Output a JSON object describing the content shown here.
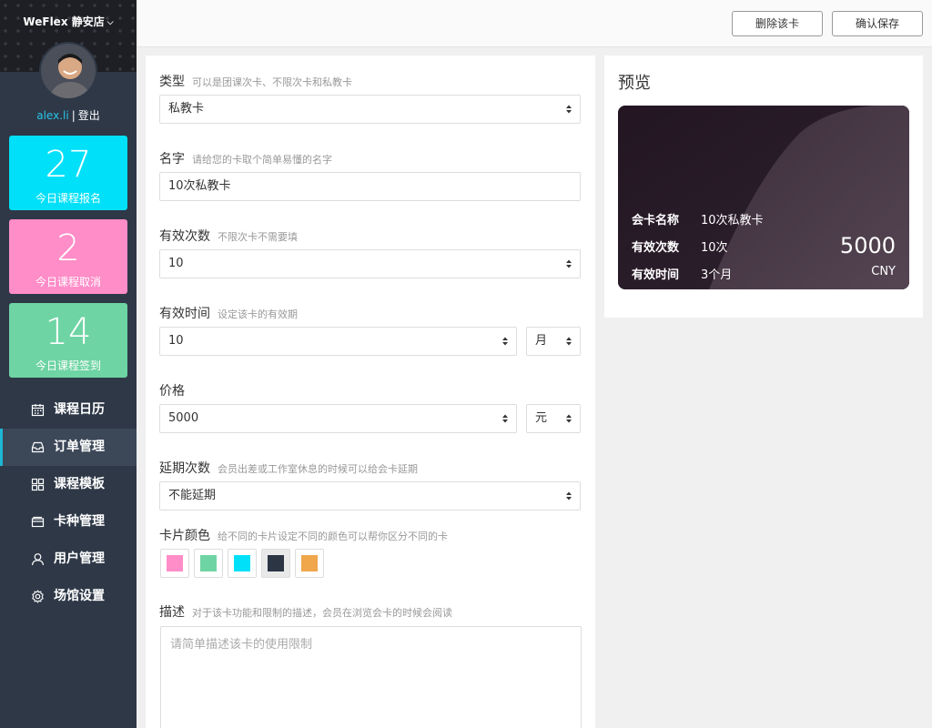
{
  "sidebar": {
    "store_name": "WeFlex 静安店",
    "username": "alex.li",
    "separator": "|",
    "logout": "登出",
    "stats": [
      {
        "value": "27",
        "label": "今日课程报名",
        "color": "#00e0f8"
      },
      {
        "value": "2",
        "label": "今日课程取消",
        "color": "#ff8dc8"
      },
      {
        "value": "14",
        "label": "今日课程签到",
        "color": "#6ed4a3"
      }
    ],
    "nav": [
      {
        "label": "课程日历",
        "icon": "calendar-icon"
      },
      {
        "label": "订单管理",
        "icon": "inbox-icon"
      },
      {
        "label": "课程模板",
        "icon": "grid-icon"
      },
      {
        "label": "卡种管理",
        "icon": "card-icon"
      },
      {
        "label": "用户管理",
        "icon": "user-icon"
      },
      {
        "label": "场馆设置",
        "icon": "gear-icon"
      }
    ],
    "active_nav": "订单管理"
  },
  "toolbar": {
    "delete_label": "删除该卡",
    "save_label": "确认保存"
  },
  "form": {
    "type": {
      "label": "类型",
      "hint": "可以是团课次卡、不限次卡和私教卡",
      "value": "私教卡"
    },
    "name": {
      "label": "名字",
      "hint": "请给您的卡取个简单易懂的名字",
      "value": "10次私教卡"
    },
    "count": {
      "label": "有效次数",
      "hint": "不限次卡不需要填",
      "value": "10"
    },
    "period": {
      "label": "有效时间",
      "hint": "设定该卡的有效期",
      "value": "10",
      "unit": "月"
    },
    "price": {
      "label": "价格",
      "hint": "",
      "value": "5000",
      "unit": "元"
    },
    "extension": {
      "label": "延期次数",
      "hint": "会员出差或工作室休息的时候可以给会卡延期",
      "value": "不能延期"
    },
    "color": {
      "label": "卡片颜色",
      "hint": "给不同的卡片设定不同的颜色可以帮你区分不同的卡",
      "options": [
        "#ff8dc8",
        "#6ed4a3",
        "#00e0f8",
        "#2b3544",
        "#f0a64a"
      ],
      "selected": "#2b3544"
    },
    "description": {
      "label": "描述",
      "hint": "对于该卡功能和限制的描述，会员在浏览会卡的时候会阅读",
      "placeholder": "请简单描述该卡的使用限制"
    }
  },
  "preview": {
    "title": "预览",
    "card": {
      "name_key": "会卡名称",
      "name_val": "10次私教卡",
      "count_key": "有效次数",
      "count_val": "10次",
      "period_key": "有效时间",
      "period_val": "3个月",
      "price": "5000",
      "currency": "CNY"
    }
  }
}
